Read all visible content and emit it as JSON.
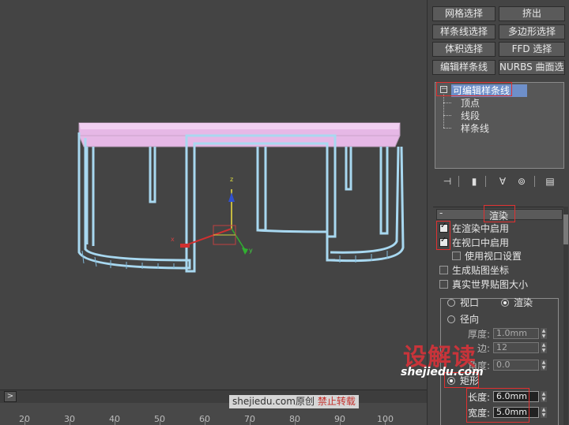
{
  "modifier_buttons": [
    [
      "网格选择",
      "挤出"
    ],
    [
      "样条线选择",
      "多边形选择"
    ],
    [
      "体积选择",
      "FFD 选择"
    ],
    [
      "编辑样条线",
      "NURBS 曲面选择"
    ]
  ],
  "stack": {
    "root": "可编辑样条线",
    "children": [
      "顶点",
      "线段",
      "样条线"
    ]
  },
  "icons": [
    "pin-stack-icon",
    "show-end-result-icon",
    "make-unique-icon",
    "remove-modifier-icon",
    "configure-modifier-sets-icon"
  ],
  "rendering_rollout": {
    "title": "渲染",
    "enable_in_renderer": "在渲染中启用",
    "enable_in_viewport": "在视口中启用",
    "use_viewport_settings": "使用视口设置",
    "generate_mapping_coords": "生成贴图坐标",
    "real_world_map_size": "真实世界贴图大小",
    "viewport_radio": "视口",
    "render_radio": "渲染",
    "radial_radio": "径向",
    "thickness_label": "厚度:",
    "thickness_value": "1.0mm",
    "sides_label": "边:",
    "sides_value": "12",
    "angle_label": "角度:",
    "angle_value": "0.0",
    "rectangular_radio": "矩形",
    "length_label": "长度:",
    "length_value": "6.0mm",
    "width_label": "宽度:",
    "width_value": "5.0mm"
  },
  "timeline": {
    "next_button": ">",
    "ticks": [
      "20",
      "30",
      "40",
      "50",
      "60",
      "70",
      "80",
      "90",
      "100"
    ]
  },
  "watermark": {
    "site": "shejiedu.com",
    "original": "原创",
    "no_repost": "禁止转载"
  },
  "logo": {
    "text": "设解读",
    "url": "shejiedu.com"
  },
  "axis_labels": {
    "z": "z",
    "y": "y",
    "x": "x"
  },
  "colors": {
    "viewport_bg": "#444444",
    "table_top": "#e6b8e6",
    "frame_edge": "#a8d8f0",
    "selection_highlight": "#6e8fc9",
    "callout_red": "#e03030"
  }
}
